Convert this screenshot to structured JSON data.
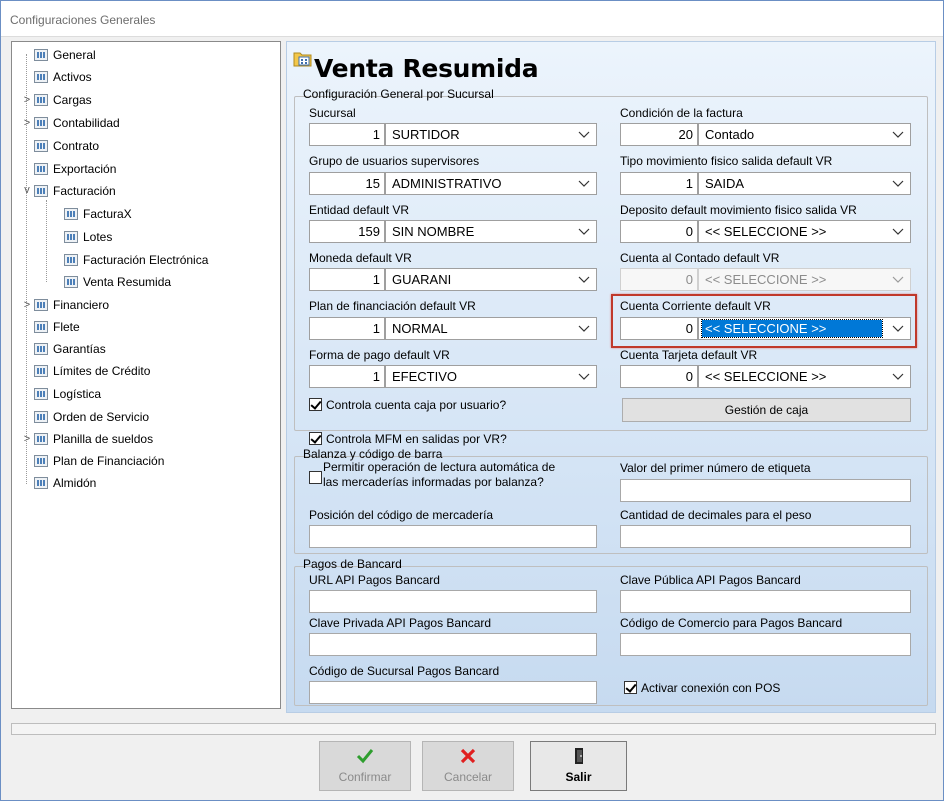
{
  "window": {
    "title": "Configuraciones Generales"
  },
  "tree": {
    "items": [
      {
        "label": "General",
        "expander": ""
      },
      {
        "label": "Activos",
        "expander": ""
      },
      {
        "label": "Cargas",
        "expander": ">"
      },
      {
        "label": "Contabilidad",
        "expander": ">"
      },
      {
        "label": "Contrato",
        "expander": ""
      },
      {
        "label": "Exportación",
        "expander": ""
      },
      {
        "label": "Facturación",
        "expander": "v"
      },
      {
        "label": "FacturaX",
        "expander": ""
      },
      {
        "label": "Lotes",
        "expander": ""
      },
      {
        "label": "Facturación Electrónica",
        "expander": ""
      },
      {
        "label": "Venta Resumida",
        "expander": ""
      },
      {
        "label": "Financiero",
        "expander": ">"
      },
      {
        "label": "Flete",
        "expander": ""
      },
      {
        "label": "Garantías",
        "expander": ""
      },
      {
        "label": "Límites de Crédito",
        "expander": ""
      },
      {
        "label": "Logística",
        "expander": ""
      },
      {
        "label": "Orden de Servicio",
        "expander": ""
      },
      {
        "label": "Planilla de sueldos",
        "expander": ">"
      },
      {
        "label": "Plan de Financiación",
        "expander": ""
      },
      {
        "label": "Almidón",
        "expander": ""
      }
    ]
  },
  "panel": {
    "title": "Venta Resumida",
    "general": {
      "legend": "Configuración General por Sucursal",
      "sucursal": {
        "label": "Sucursal",
        "code": "1",
        "value": "SURTIDOR"
      },
      "grupo": {
        "label": "Grupo de usuarios supervisores",
        "code": "15",
        "value": "ADMINISTRATIVO"
      },
      "entidad": {
        "label": "Entidad default VR",
        "code": "159",
        "value": "SIN NOMBRE"
      },
      "moneda": {
        "label": "Moneda default VR",
        "code": "1",
        "value": "GUARANI"
      },
      "plan": {
        "label": "Plan de financiación default VR",
        "code": "1",
        "value": "NORMAL"
      },
      "forma": {
        "label": "Forma de pago default VR",
        "code": "1",
        "value": "EFECTIVO"
      },
      "condicion": {
        "label": "Condición de la factura",
        "code": "20",
        "value": "Contado"
      },
      "tipo_mov": {
        "label": "Tipo movimiento fisico salida default VR",
        "code": "1",
        "value": "SAIDA"
      },
      "deposito": {
        "label": "Deposito default movimiento fisico salida VR",
        "code": "0",
        "value": "<< SELECCIONE >>"
      },
      "cuenta_contado": {
        "label": "Cuenta al Contado default VR",
        "code": "0",
        "value": "<< SELECCIONE >>"
      },
      "cuenta_corriente": {
        "label": "Cuenta Corriente default VR",
        "code": "0",
        "value": "<< SELECCIONE >>"
      },
      "cuenta_tarjeta": {
        "label": "Cuenta Tarjeta default VR",
        "code": "0",
        "value": "<< SELECCIONE >>"
      },
      "controla_caja": "Controla cuenta caja por usuario?",
      "gestion_caja": "Gestión de caja"
    },
    "controla_mfm": "Controla MFM en salidas por VR?",
    "balanza": {
      "legend": "Balanza y código de barra",
      "permitir_line1": "Permitir operación de lectura automática de",
      "permitir_line2": "las mercaderías informadas por balanza?",
      "valor_etiqueta": "Valor del primer número de etiqueta",
      "posicion": "Posición del código de mercadería",
      "decimales": "Cantidad de decimales para el peso"
    },
    "bancard": {
      "legend": "Pagos de Bancard",
      "url": "URL API Pagos Bancard",
      "publica": "Clave Pública API Pagos Bancard",
      "privada": "Clave Privada API Pagos Bancard",
      "comercio": "Código de Comercio para Pagos Bancard",
      "sucursal": "Código de Sucursal Pagos Bancard",
      "pos": "Activar conexión con POS"
    }
  },
  "actions": {
    "confirmar": "Confirmar",
    "cancelar": "Cancelar",
    "salir": "Salir"
  },
  "colors": {
    "highlight": "#0078d7",
    "focus_frame": "#c0392b",
    "confirm_icon": "#2e9e2e",
    "cancel_icon": "#e02020"
  }
}
